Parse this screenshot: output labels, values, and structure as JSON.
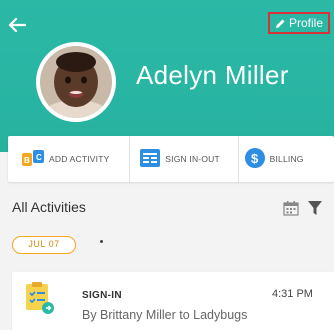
{
  "header": {
    "child_name": "Adelyn Miller",
    "profile_label": "Profile",
    "background_color": "#2bb9a6",
    "highlight_color": "#d6323a"
  },
  "actions": [
    {
      "label": "ADD ACTIVITY",
      "icon": "add-activity-icon"
    },
    {
      "label": "SIGN IN-OUT",
      "icon": "sign-in-out-icon"
    },
    {
      "label": "BILLING",
      "icon": "billing-dollar-icon"
    }
  ],
  "activities": {
    "title": "All Activities",
    "date_label": "JUL 07",
    "items": [
      {
        "type_label": "SIGN-IN",
        "time": "4:31 PM",
        "description": "By Brittany Miller to Ladybugs",
        "icon": "sign-in-clipboard-icon"
      }
    ]
  },
  "accent": {
    "teal": "#2bb9a6",
    "orange": "#f5a623",
    "blue": "#2d8ee4"
  }
}
